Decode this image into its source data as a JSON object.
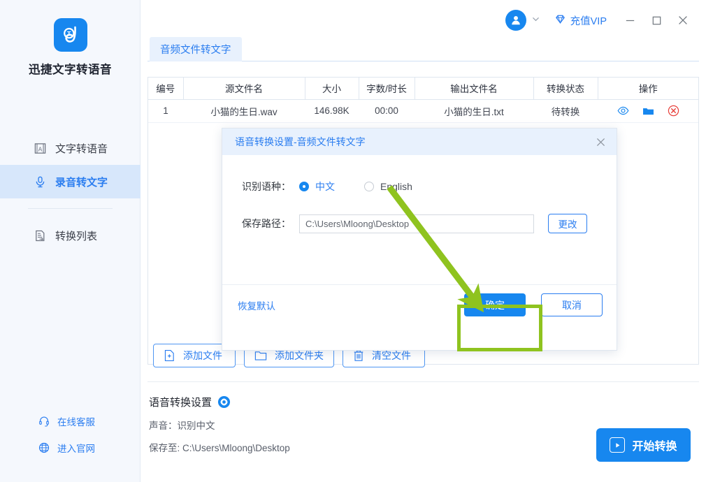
{
  "sidebar": {
    "logo_icon": "app-logo-icon",
    "app_title": "迅捷文字转语音",
    "items": [
      {
        "label": "文字转语音",
        "icon": "text-to-speech-icon",
        "active": false
      },
      {
        "label": "录音转文字",
        "icon": "microphone-icon",
        "active": true
      },
      {
        "label": "转换列表",
        "icon": "conversion-list-icon",
        "active": false
      }
    ],
    "links": [
      {
        "label": "在线客服",
        "icon": "customer-service-icon"
      },
      {
        "label": "进入官网",
        "icon": "globe-icon"
      }
    ]
  },
  "titlebar": {
    "avatar_icon": "user-avatar-icon",
    "dropdown_icon": "chevron-down-icon",
    "vip_label": "充值VIP",
    "vip_icon": "diamond-icon",
    "minimize_icon": "minimize-icon",
    "maximize_icon": "maximize-icon",
    "close_icon": "close-icon"
  },
  "tabs": [
    {
      "label": "音频文件转文字",
      "active": true
    }
  ],
  "table": {
    "columns": [
      "编号",
      "源文件名",
      "大小",
      "字数/时长",
      "输出文件名",
      "转换状态",
      "操作"
    ],
    "rows": [
      {
        "index": "1",
        "source_name": "小猫的生日.wav",
        "size": "146.98K",
        "duration": "00:00",
        "output_name": "小猫的生日.txt",
        "status": "待转换",
        "actions": [
          "eye-icon",
          "folder-icon",
          "delete-icon"
        ]
      }
    ]
  },
  "file_buttons": [
    {
      "label": "添加文件",
      "icon": "add-file-icon"
    },
    {
      "label": "添加文件夹",
      "icon": "add-folder-icon"
    },
    {
      "label": "清空文件",
      "icon": "trash-icon"
    }
  ],
  "settings_summary": {
    "title": "语音转换设置",
    "gear_icon": "gear-icon",
    "voice_line": "声音：识别中文",
    "save_line": "保存至: C:\\Users\\Mloong\\Desktop"
  },
  "start_button": {
    "label": "开始转换",
    "icon": "play-icon"
  },
  "modal": {
    "title": "语音转换设置-音频文件转文字",
    "close_icon": "close-icon",
    "language_label": "识别语种：",
    "language_options": [
      {
        "label": "中文",
        "selected": true
      },
      {
        "label": "English",
        "selected": false
      }
    ],
    "path_label": "保存路径：",
    "path_value": "C:\\Users\\Mloong\\Desktop",
    "change_label": "更改",
    "reset_label": "恢复默认",
    "ok_label": "确定",
    "cancel_label": "取消"
  },
  "annotation": {
    "type": "arrow-and-highlight",
    "color": "#8fc31f",
    "target": "确定"
  },
  "colors": {
    "accent": "#1787ef",
    "link": "#2a7df0",
    "sidebar_bg": "#f5f8fd",
    "active_nav_bg": "#d7e7fb",
    "tab_bg": "#e8f1fd",
    "annotation_green": "#8fc31f",
    "delete_red": "#e8413c"
  }
}
